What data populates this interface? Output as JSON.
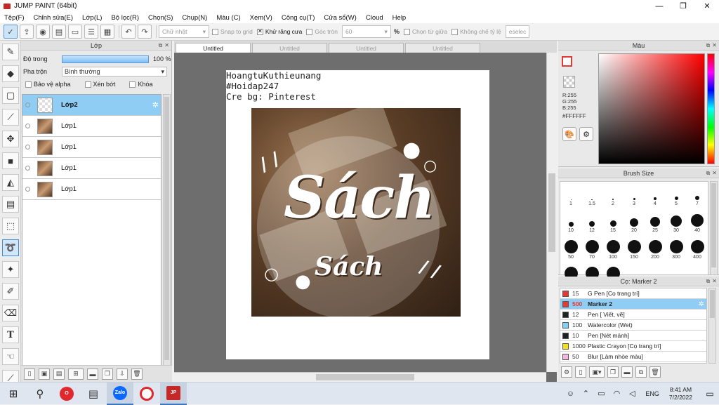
{
  "window": {
    "title": "JUMP PAINT (64bit)",
    "min_glyph": "—",
    "max_glyph": "❐",
    "close_glyph": "✕"
  },
  "menu": [
    "Tệp(F)",
    "Chỉnh sửa(E)",
    "Lớp(L)",
    "Bộ lọc(R)",
    "Chọn(S)",
    "Chụp(N)",
    "Màu (C)",
    "Xem(V)",
    "Công cụ(T)",
    "Cửa sổ(W)",
    "Cloud",
    "Help"
  ],
  "toolbar": {
    "shape_select": "Chữ nhật",
    "snap_grid": "Snap to grid",
    "antialias": "Khử răng cưa",
    "corner": "Góc tròn",
    "corner_value": "60",
    "percent": "%",
    "select_center": "Chọn từ giữa",
    "ratio_limit": "Không chế tỷ lệ",
    "deselect": "eselec"
  },
  "layer_panel": {
    "title": "Lớp",
    "opacity_label": "Độ trong",
    "opacity_value": "100 %",
    "blend_label": "Pha trộn",
    "blend_value": "Bình thường",
    "protect_alpha": "Bảo vệ alpha",
    "clip": "Xén bớt",
    "lock": "Khóa",
    "layers": [
      {
        "name": "Lớp2",
        "selected": true
      },
      {
        "name": "Lớp1",
        "selected": false
      },
      {
        "name": "Lớp1",
        "selected": false
      },
      {
        "name": "Lớp1",
        "selected": false
      },
      {
        "name": "Lớp1",
        "selected": false
      }
    ]
  },
  "canvas": {
    "tabs": [
      "Untitled",
      "Untitled",
      "Untitled",
      "Untitled"
    ],
    "text_line1": "HoangtuKuthieunang",
    "text_line2": "#Hoidap247",
    "text_line3": "Cre bg: Pinterest",
    "art_big": "Sách",
    "art_small": "Sách"
  },
  "color_panel": {
    "title": "Màu",
    "r": "R:255",
    "g": "G:255",
    "b": "B:255",
    "hex": "#FFFFFF"
  },
  "brush_panel": {
    "title": "Brush Size",
    "sizes": [
      "1",
      "1.5",
      "2",
      "3",
      "4",
      "5",
      "7",
      "10",
      "12",
      "15",
      "20",
      "25",
      "30",
      "40",
      "50",
      "70",
      "100",
      "150",
      "200",
      "300",
      "400",
      "",
      "",
      ""
    ]
  },
  "tool_panel": {
    "title": "Cọ: Marker 2",
    "items": [
      {
        "size": "15",
        "name": "G Pen [Cọ trang trí]",
        "color": "#e53935",
        "selected": false
      },
      {
        "size": "500",
        "name": "Marker 2",
        "color": "#e53935",
        "selected": true
      },
      {
        "size": "12",
        "name": "Pen [ Viết, vẽ]",
        "color": "#222222",
        "selected": false
      },
      {
        "size": "100",
        "name": "Watercolor (Wet)",
        "color": "#7fd3f5",
        "selected": false
      },
      {
        "size": "10",
        "name": "Pen [Nét mảnh]",
        "color": "#222222",
        "selected": false
      },
      {
        "size": "1000",
        "name": "Plastic Crayon [Cọ trang trí]",
        "color": "#f5e11b",
        "selected": false
      },
      {
        "size": "50",
        "name": "Blur [Làm nhòe màu]",
        "color": "#f3b7e0",
        "selected": false
      }
    ]
  },
  "taskbar": {
    "lang": "ENG",
    "time": "8:41 AM",
    "date": "7/2/2022",
    "zalo": "Zalo"
  }
}
